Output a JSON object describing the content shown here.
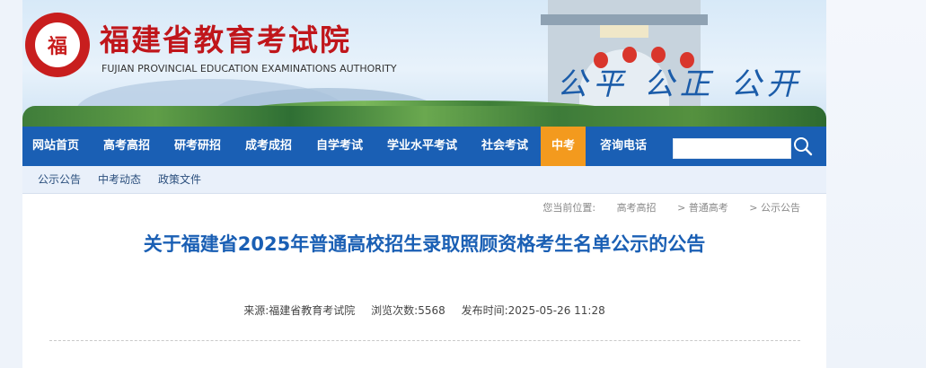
{
  "header": {
    "title": "福建省教育考试院",
    "subtitle": "FUJIAN PROVINCIAL EDUCATION EXAMINATIONS AUTHORITY",
    "slogan": "公平 公正 公开",
    "brand_color": "#c0161b"
  },
  "nav": {
    "items": [
      "网站首页",
      "高考高招",
      "研考研招",
      "成考成招",
      "自学考试",
      "学业水平考试",
      "社会考试",
      "中考",
      "咨询电话"
    ],
    "active": "中考",
    "accent_color": "#f39a1e",
    "bar_color": "#1a5fb4",
    "search_placeholder": "",
    "search_icon": "search-icon"
  },
  "subnav": {
    "items": [
      "公示公告",
      "中考动态",
      "政策文件"
    ]
  },
  "breadcrumb": {
    "label": "您当前位置:",
    "items": [
      "高考高招",
      "> 普通高考",
      "> 公示公告"
    ]
  },
  "article": {
    "title": "关于福建省2025年普通高校招生录取照顾资格考生名单公示的公告",
    "source_label": "来源:",
    "source": "福建省教育考试院",
    "views_label": "浏览次数:",
    "views": "5568",
    "date_label": "发布时间:",
    "date": "2025-05-26 11:28"
  }
}
